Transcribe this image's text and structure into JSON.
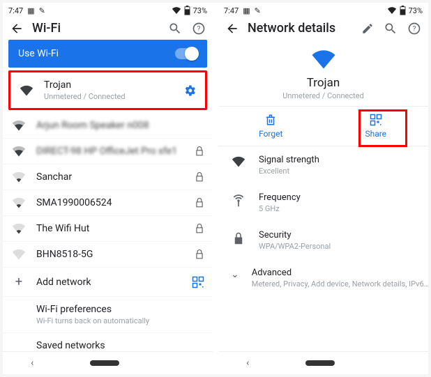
{
  "status": {
    "time": "7:47",
    "battery": "73%"
  },
  "left": {
    "title": "Wi-Fi",
    "use_wifi": "Use Wi-Fi",
    "networks": [
      {
        "name": "Trojan",
        "sub": "Unmetered / Connected"
      },
      {
        "name": "Arjun Room Speaker n008"
      },
      {
        "name": "DIRECT-98 HP OfficeJet Pro xfe1"
      },
      {
        "name": "Sanchar"
      },
      {
        "name": "SMA1990006524"
      },
      {
        "name": "The Wifi Hut"
      },
      {
        "name": "BHN8518-5G"
      }
    ],
    "add_network": "Add network",
    "prefs": {
      "title": "Wi-Fi preferences",
      "sub": "Wi-Fi turns back on automatically"
    },
    "saved": "Saved networks"
  },
  "right": {
    "title": "Network details",
    "net": {
      "name": "Trojan",
      "sub": "Unmetered / Connected"
    },
    "forget": "Forget",
    "share": "Share",
    "signal": {
      "k": "Signal strength",
      "v": "Excellent"
    },
    "freq": {
      "k": "Frequency",
      "v": "5 GHz"
    },
    "sec": {
      "k": "Security",
      "v": "WPA/WPA2-Personal"
    },
    "adv": {
      "k": "Advanced",
      "v": "Metered, Privacy, Add device, Network details, IPv6…"
    }
  }
}
